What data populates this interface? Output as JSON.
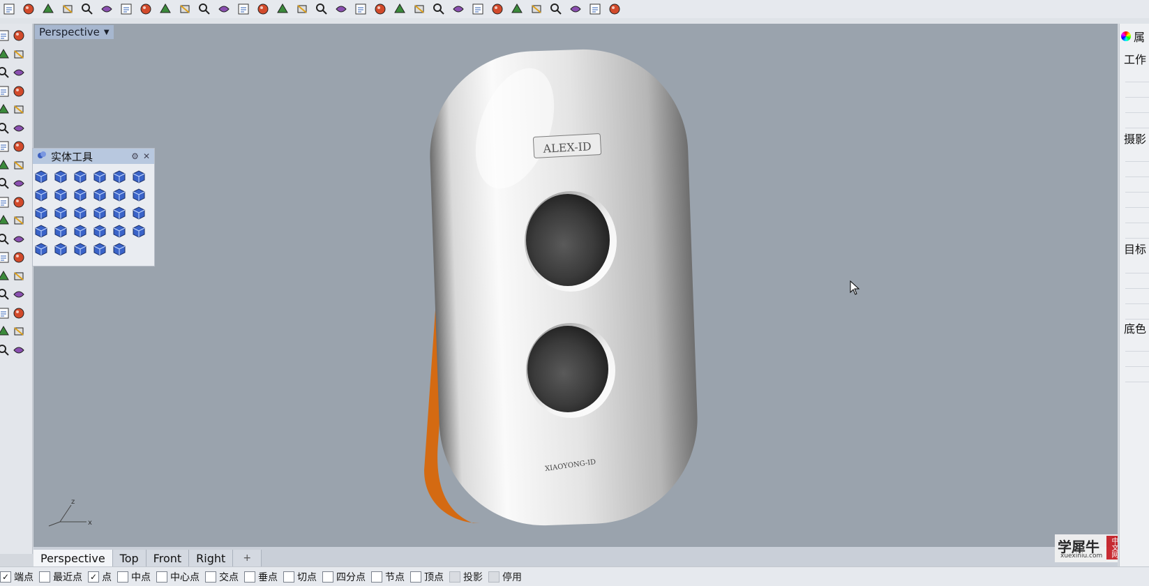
{
  "toolbar": {
    "icons": [
      "new-icon",
      "open-folder-icon",
      "save-icon",
      "print-icon",
      "import-icon",
      "cut-icon",
      "copy-icon",
      "paste-icon",
      "undo-icon",
      "pan-hand-icon",
      "rotate-view-icon",
      "zoom-icon",
      "zoom-window-icon",
      "zoom-extents-icon",
      "zoom-selected-icon",
      "undo-view-icon",
      "four-viewports-icon",
      "car-icon",
      "layer-icon",
      "cplane-icon",
      "gumball-icon",
      "light-icon",
      "lock-icon",
      "material-icon",
      "color-wheel-icon",
      "shaded-sphere-icon",
      "rendered-sphere-icon",
      "globe-icon",
      "select-filter-icon",
      "options-gear-icon",
      "dimension-icon",
      "help-icon"
    ]
  },
  "viewport": {
    "title": "Perspective",
    "product_logo_text": "ALEX-ID",
    "product_bottom_text": "XIAOYONG-ID",
    "axis_z": "z",
    "axis_x": "x",
    "background": "#9aa3ad",
    "accent_orange": "#d46a12"
  },
  "floating_toolbar": {
    "title": "实体工具",
    "rows": 5
  },
  "tabs": [
    {
      "label": "Perspective",
      "active": true
    },
    {
      "label": "Top",
      "active": false
    },
    {
      "label": "Front",
      "active": false
    },
    {
      "label": "Right",
      "active": false
    },
    {
      "label": "+",
      "active": false
    }
  ],
  "osnaps": [
    {
      "label": "端点",
      "checked": true,
      "disabled": false
    },
    {
      "label": "最近点",
      "checked": false,
      "disabled": false
    },
    {
      "label": "点",
      "checked": true,
      "disabled": false
    },
    {
      "label": "中点",
      "checked": false,
      "disabled": false
    },
    {
      "label": "中心点",
      "checked": false,
      "disabled": false
    },
    {
      "label": "交点",
      "checked": false,
      "disabled": false
    },
    {
      "label": "垂点",
      "checked": false,
      "disabled": false
    },
    {
      "label": "切点",
      "checked": false,
      "disabled": false
    },
    {
      "label": "四分点",
      "checked": false,
      "disabled": false
    },
    {
      "label": "节点",
      "checked": false,
      "disabled": false
    },
    {
      "label": "顶点",
      "checked": false,
      "disabled": false
    },
    {
      "label": "投影",
      "checked": false,
      "disabled": true
    },
    {
      "label": "停用",
      "checked": false,
      "disabled": true
    }
  ],
  "right_panel": {
    "header": "属",
    "sections": [
      "工作",
      "摄影",
      "目标",
      "底色"
    ]
  },
  "watermark": {
    "main": "学犀牛",
    "sub": "xuexiniu.com",
    "seal": "中文网"
  }
}
